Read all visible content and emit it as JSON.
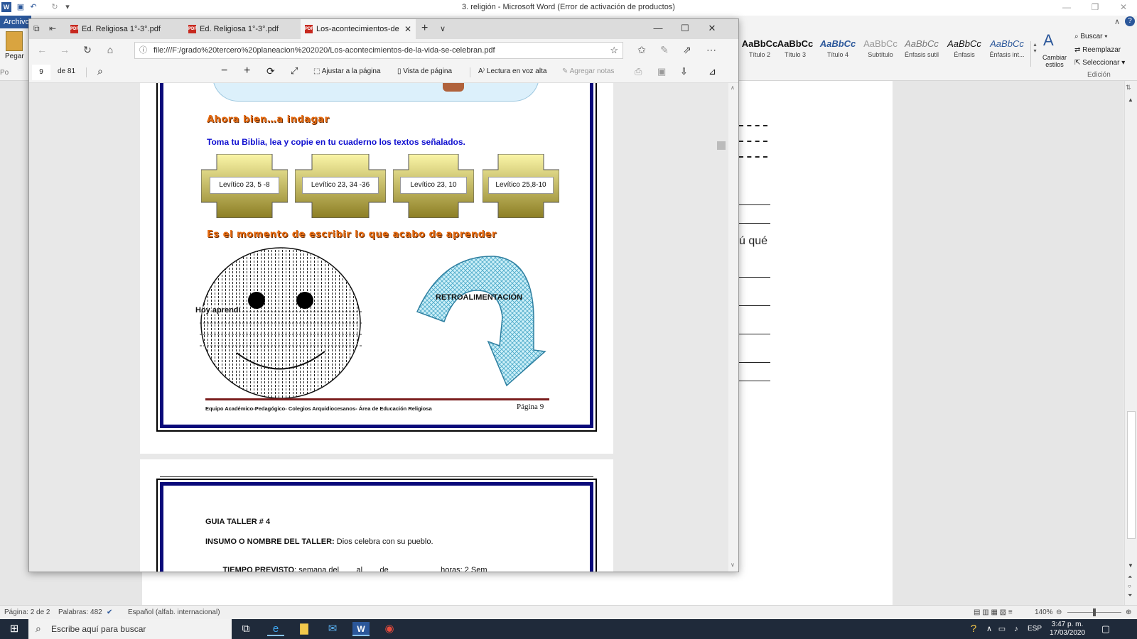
{
  "word": {
    "title": "3. religión  -  Microsoft Word (Error de activación de productos)",
    "archivo_tab": "Archivo",
    "ribbon": {
      "paste_label": "Pegar",
      "styles": [
        {
          "sample": "AaBbCc",
          "name": "Título 2"
        },
        {
          "sample": "AaBbCc",
          "name": "Título 3"
        },
        {
          "sample": "AaBbCc",
          "name": "Título 4"
        },
        {
          "sample": "AaBbCc",
          "name": "Subtítulo"
        },
        {
          "sample": "AaBbCc",
          "name": "Énfasis sutil"
        },
        {
          "sample": "AaBbCc",
          "name": "Énfasis"
        },
        {
          "sample": "AaBbCc",
          "name": "Énfasis int..."
        }
      ],
      "change_styles": "Cambiar estilos",
      "find": "Buscar",
      "replace": "Reemplazar",
      "select": "Seleccionar",
      "edition_group": "Edición"
    },
    "doc_fragment_text": "ú qué",
    "status": {
      "page": "Página: 2 de 2",
      "words": "Palabras: 482",
      "language": "Español (alfab. internacional)",
      "zoom": "140%"
    }
  },
  "edge": {
    "tabs": [
      {
        "label": "Ed. Religiosa 1°-3°.pdf"
      },
      {
        "label": "Ed. Religiosa 1°-3°.pdf"
      },
      {
        "label": "Los-acontecimientos-de"
      }
    ],
    "url": "file:///F:/grado%20tercero%20planeacion%202020/Los-acontecimientos-de-la-vida-se-celebran.pdf",
    "pdf_toolbar": {
      "page_number": "9",
      "page_total": "de 81",
      "fit_page": "Ajustar a la página",
      "page_view": "Vista de página",
      "read_aloud": "Lectura en voz alta",
      "add_notes": "Agregar notas"
    },
    "page9": {
      "heading1": "Ahora bien…a indagar",
      "instruction": "Toma tu Biblia, lea y copie en tu cuaderno los textos señalados.",
      "crosses": [
        "Levítico 23, 5 -8",
        "Levítico 23, 34 -36",
        "Levítico 23, 10",
        "Levítico 25,8-10"
      ],
      "heading2": "Es el momento de escribir lo que acabo de aprender",
      "smiley_label": "Hoy aprendí",
      "arrow_label": "RETROALIMENTACIÓN",
      "footer_left": "Equipo Académico-Pedagógico- Colegios Arquidiocesanos- Área de Educación Religiosa",
      "footer_right": "Página 9"
    },
    "page10": {
      "guia": "GUIA TALLER #  4",
      "insumo_label": "INSUMO O NOMBRE DEL TALLER:",
      "insumo_value": " Dios celebra con su pueblo.",
      "tiempo_label": "TIEMPO PREVISTO",
      "tiempo_value": ": semana del        al        de                        horas: 2 Sem"
    }
  },
  "taskbar": {
    "search_placeholder": "Escribe aquí para buscar",
    "lang": "ESP",
    "time": "3:47 p. m.",
    "date": "17/03/2020"
  },
  "colors": {
    "word_blue": "#2b579a",
    "pdf_frame_blue": "#0a0a7a",
    "heading_orange": "#e56a10",
    "instruction_blue": "#1010d0",
    "arrow_cyan": "#9fe0f0"
  }
}
